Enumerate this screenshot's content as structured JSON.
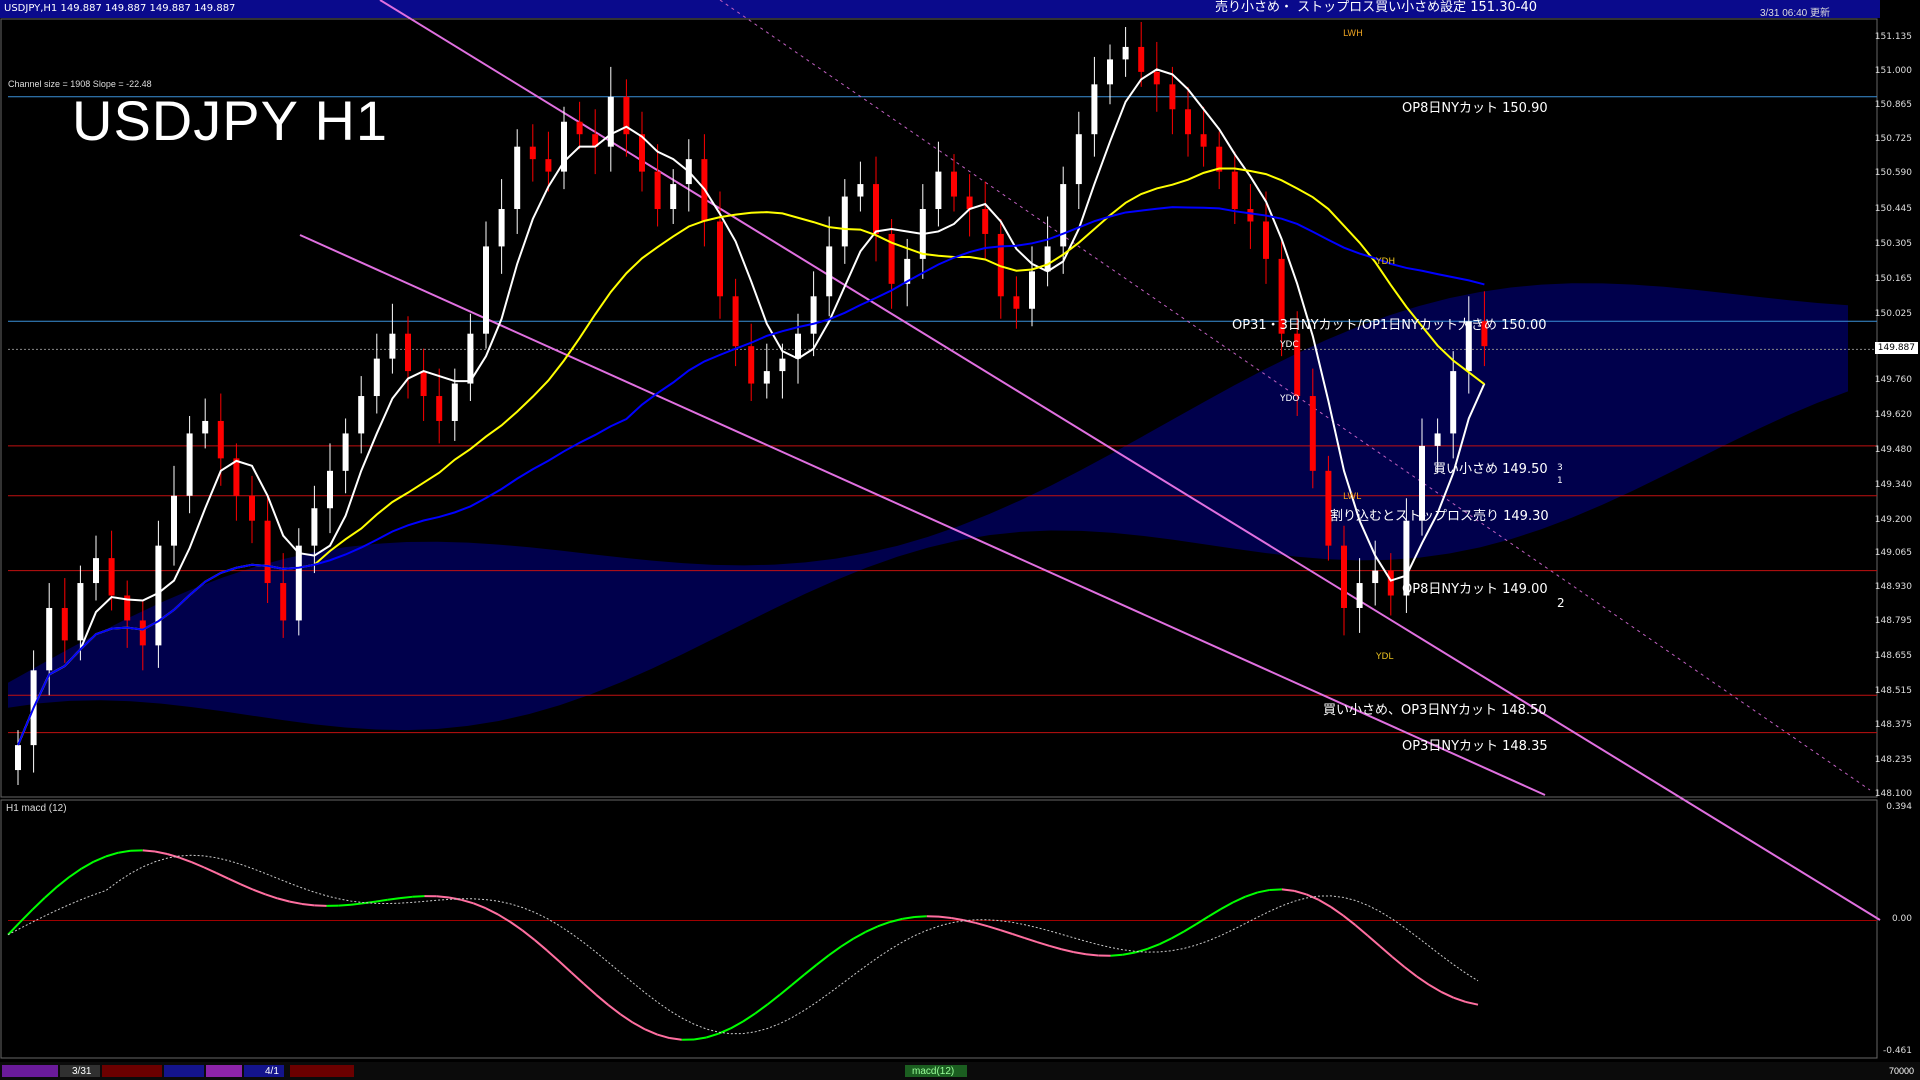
{
  "header": {
    "info": "USDJPY,H1  149.887  149.887  149.887  149.887",
    "updated": "3/31 06:40 更新"
  },
  "title": "USDJPY H1",
  "channel_info": "Channel size = 1908 Slope = -22.48",
  "indicator_label": "H1  macd (12)",
  "price_axis": {
    "ticks": [
      "151.135",
      "151.000",
      "150.865",
      "150.725",
      "150.590",
      "150.445",
      "150.305",
      "150.165",
      "150.025",
      "149.887",
      "149.760",
      "149.620",
      "149.480",
      "149.340",
      "149.200",
      "149.065",
      "148.930",
      "148.795",
      "148.655",
      "148.515",
      "148.375",
      "148.235",
      "148.100"
    ],
    "current": "149.887"
  },
  "macd_axis": {
    "top": "0.394",
    "zero": "0.00",
    "bottom": "-0.461"
  },
  "annotations": [
    {
      "text": "売り小さめ・ ストップロス買い小さめ設定 151.30-40",
      "color": "#ffffff"
    },
    {
      "text": "OP8日NYカット 150.90",
      "color": "#ffffff"
    },
    {
      "text": "OP31・3日NYカット/OP1日NYカット大きめ 150.00",
      "color": "#ffffff"
    },
    {
      "text": "買い小さめ 149.50",
      "color": "#ffffff"
    },
    {
      "text": "割り込むとストップロス売り 149.30",
      "color": "#ffffff"
    },
    {
      "text": "OP8日NYカット 149.00",
      "color": "#ffffff"
    },
    {
      "text": "買い小さめ、OP3日NYカット 148.50",
      "color": "#ffffff"
    },
    {
      "text": "OP3日NYカット 148.35",
      "color": "#ffffff"
    }
  ],
  "box_labels": {
    "lwh": "LWH",
    "lwl": "LWL",
    "ydh": "YDH",
    "ydl": "YDL",
    "ydc": "YDC",
    "ydo": "YDO",
    "r1": "1",
    "r2": "2",
    "r3": "3"
  },
  "bottom_bar": {
    "d1": "3/31",
    "d2": "4/1",
    "tab": "macd(12)",
    "vol": "70000"
  },
  "colors": {
    "bg": "#000000",
    "up": "#ffffff",
    "down": "#ff0000",
    "ma_fast": "#ffffff",
    "ma_mid": "#ffff00",
    "ma_slow": "#0000ff",
    "channel": "#e070e0",
    "kumo": "#00008b",
    "macd_up": "#00ff00",
    "macd_down": "#ff6fa0"
  },
  "chart_data": {
    "type": "candlestick",
    "timeframe": "H1",
    "symbol": "USDJPY",
    "ylim": [
      148.1,
      151.2
    ],
    "ohlc_close": [
      148.3,
      148.6,
      148.85,
      148.72,
      148.95,
      149.05,
      148.9,
      148.8,
      148.7,
      149.1,
      149.3,
      149.55,
      149.6,
      149.45,
      149.3,
      149.2,
      148.95,
      148.8,
      149.1,
      149.25,
      149.4,
      149.55,
      149.7,
      149.85,
      149.95,
      149.8,
      149.7,
      149.6,
      149.75,
      149.95,
      150.3,
      150.45,
      150.7,
      150.65,
      150.6,
      150.8,
      150.75,
      150.7,
      150.9,
      150.75,
      150.6,
      150.45,
      150.55,
      150.65,
      150.4,
      150.1,
      149.9,
      149.75,
      149.8,
      149.85,
      149.95,
      150.1,
      150.3,
      150.5,
      150.55,
      150.35,
      150.15,
      150.25,
      150.45,
      150.6,
      150.5,
      150.45,
      150.35,
      150.1,
      150.05,
      150.2,
      150.3,
      150.55,
      150.75,
      150.95,
      151.05,
      151.1,
      151.0,
      150.95,
      150.85,
      150.75,
      150.7,
      150.6,
      150.45,
      150.4,
      150.25,
      149.95,
      149.7,
      149.4,
      149.1,
      148.85,
      148.95,
      149.0,
      148.9,
      149.2,
      149.5,
      149.55,
      149.8,
      150.0,
      149.9
    ],
    "macd": {
      "zero": 0.0,
      "range": [
        -0.461,
        0.394
      ]
    },
    "levels": [
      {
        "label": "OP8日NYカット 150.90",
        "price": 150.9
      },
      {
        "label": "OP31・3日NYカット/OP1日NYカット大きめ 150.00",
        "price": 150.0
      },
      {
        "label": "買い小さめ 149.50",
        "price": 149.5
      },
      {
        "label": "割り込むとストップロス売り 149.30",
        "price": 149.3
      },
      {
        "label": "OP8日NYカット 149.00",
        "price": 149.0
      },
      {
        "label": "買い小さめ、OP3日NYカット 148.50",
        "price": 148.5
      },
      {
        "label": "OP3日NYカット 148.35",
        "price": 148.35
      }
    ]
  }
}
